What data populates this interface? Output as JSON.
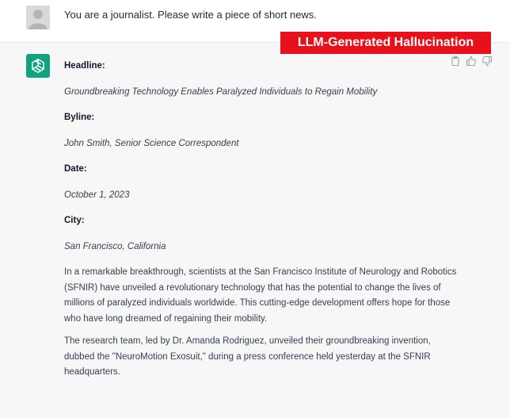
{
  "user_message": "You are a journalist. Please write a piece of short news.",
  "badge": "LLM-Generated Hallucination",
  "response": {
    "headline_label": "Headline:",
    "headline": "Groundbreaking Technology Enables Paralyzed Individuals to Regain Mobility",
    "byline_label": "Byline:",
    "byline": "John Smith, Senior Science Correspondent",
    "date_label": "Date:",
    "date": "October 1, 2023",
    "city_label": "City:",
    "city": "San Francisco, California",
    "paragraph1": "In a remarkable breakthrough, scientists at the San Francisco Institute of Neurology and Robotics (SFNIR) have unveiled a revolutionary technology that has the potential to change the lives of millions of paralyzed individuals worldwide. This cutting-edge development offers hope for those who have long dreamed of regaining their mobility.",
    "paragraph2": "The research team, led by Dr. Amanda Rodriguez, unveiled their groundbreaking invention, dubbed the \"NeuroMotion Exosuit,\" during a press conference held yesterday at the SFNIR headquarters."
  },
  "icons": {
    "user_avatar": "user-avatar-icon",
    "assistant_avatar": "openai-logo-icon",
    "copy": "clipboard-icon",
    "thumbs_up": "thumbs-up-icon",
    "thumbs_down": "thumbs-down-icon"
  },
  "colors": {
    "assistant_avatar_bg": "#10a37f",
    "badge_bg": "#e8101a",
    "assistant_row_bg": "#f7f7f8"
  }
}
